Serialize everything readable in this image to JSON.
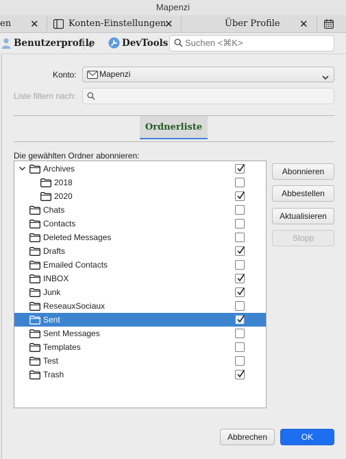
{
  "window": {
    "title": "Mapenzi"
  },
  "tabs": [
    {
      "label": "en",
      "close": "✕"
    },
    {
      "label": "Konten-Einstellungen",
      "close": "✕"
    },
    {
      "label": "Über Profile",
      "close": "✕"
    }
  ],
  "toolbar": {
    "profiles_label": "Benutzerprofile",
    "devtools_label": "DevTools",
    "search_placeholder": "Suchen <⌘K>"
  },
  "dialog": {
    "account_label": "Konto:",
    "account_value": "Mapenzi",
    "filter_label": "Liste filtern nach:",
    "filter_value": "",
    "tab_label": "Ordnerliste",
    "subscribe_heading": "Die gewählten Ordner abonnieren:",
    "folders": [
      {
        "name": "Archives",
        "checked": true,
        "level": 0,
        "expanded": true,
        "selected": false
      },
      {
        "name": "2018",
        "checked": false,
        "level": 1,
        "selected": false
      },
      {
        "name": "2020",
        "checked": true,
        "level": 1,
        "selected": false
      },
      {
        "name": "Chats",
        "checked": false,
        "level": 0,
        "selected": false
      },
      {
        "name": "Contacts",
        "checked": false,
        "level": 0,
        "selected": false
      },
      {
        "name": "Deleted Messages",
        "checked": false,
        "level": 0,
        "selected": false
      },
      {
        "name": "Drafts",
        "checked": true,
        "level": 0,
        "selected": false
      },
      {
        "name": "Emailed Contacts",
        "checked": false,
        "level": 0,
        "selected": false
      },
      {
        "name": "INBOX",
        "checked": true,
        "level": 0,
        "selected": false
      },
      {
        "name": "Junk",
        "checked": true,
        "level": 0,
        "selected": false
      },
      {
        "name": "ReseauxSociaux",
        "checked": false,
        "level": 0,
        "selected": false
      },
      {
        "name": "Sent",
        "checked": true,
        "level": 0,
        "selected": true
      },
      {
        "name": "Sent Messages",
        "checked": false,
        "level": 0,
        "selected": false
      },
      {
        "name": "Templates",
        "checked": false,
        "level": 0,
        "selected": false
      },
      {
        "name": "Test",
        "checked": false,
        "level": 0,
        "selected": false
      },
      {
        "name": "Trash",
        "checked": true,
        "level": 0,
        "selected": false
      }
    ],
    "buttons": {
      "subscribe": "Abonnieren",
      "unsubscribe": "Abbestellen",
      "refresh": "Aktualisieren",
      "stop": "Stopp",
      "cancel": "Abbrechen",
      "ok": "OK"
    }
  },
  "colors": {
    "selection": "#3c84cf",
    "ok_button": "#1e6ff0",
    "tab_underline": "#3f84d8",
    "tab_text": "#245d24"
  }
}
